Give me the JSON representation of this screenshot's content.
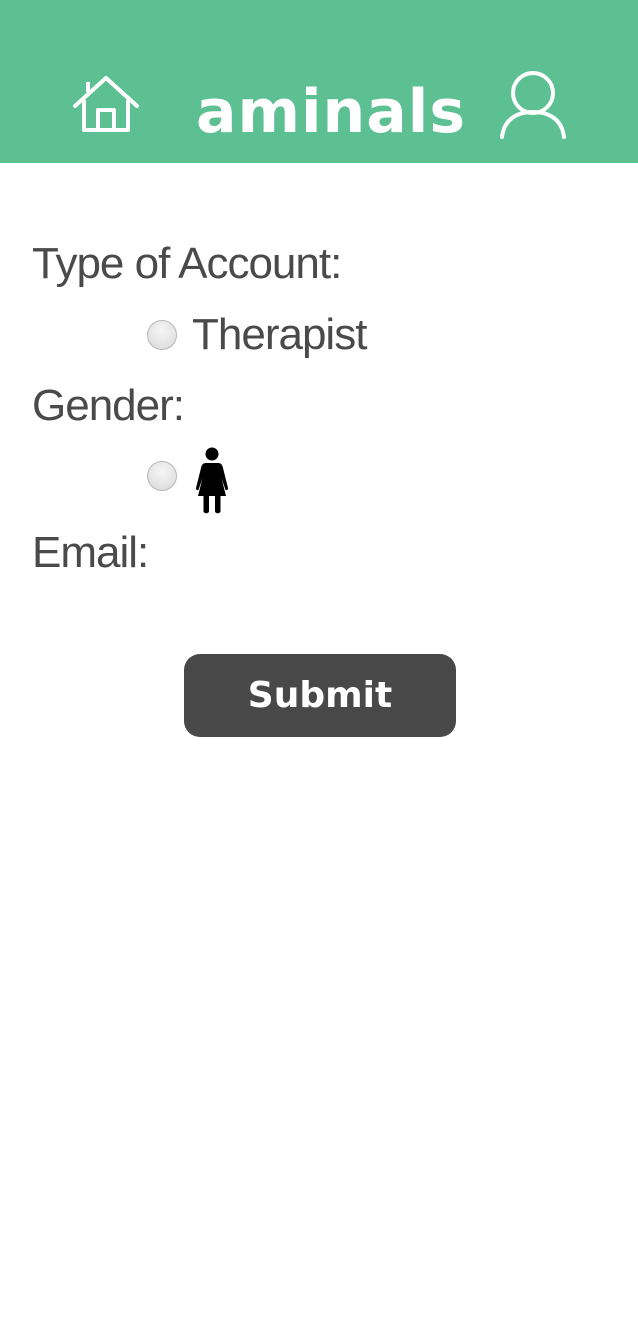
{
  "header": {
    "title": "aminals",
    "background": "#5cc093",
    "icons": {
      "home": "home-icon",
      "profile": "user-icon"
    }
  },
  "form": {
    "account_type": {
      "label": "Type of Account:",
      "options": [
        {
          "label": "Therapist",
          "selected": false
        }
      ]
    },
    "gender": {
      "label": "Gender:",
      "options": [
        {
          "icon": "female-icon",
          "selected": false
        }
      ]
    },
    "email": {
      "label": "Email:"
    },
    "submit_label": "Submit"
  }
}
